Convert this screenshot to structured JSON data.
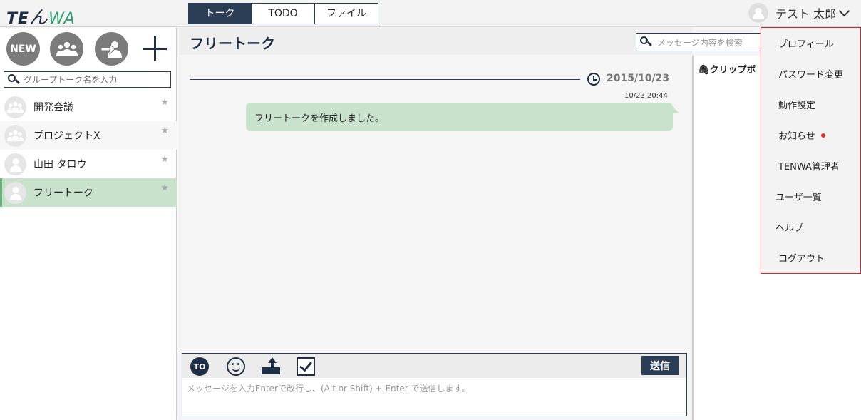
{
  "app": {
    "logo_te": "TE",
    "logo_n": "ん",
    "logo_wa": "WA"
  },
  "tabs": [
    {
      "label": "トーク",
      "active": true
    },
    {
      "label": "TODO",
      "active": false
    },
    {
      "label": "ファイル",
      "active": false
    }
  ],
  "user": {
    "name": "テスト 太郎"
  },
  "sidebar": {
    "new_label": "NEW",
    "search_placeholder": "グループトーク名を入力",
    "rooms": [
      {
        "name": "開発会議",
        "type": "group"
      },
      {
        "name": "プロジェクトX",
        "type": "group"
      },
      {
        "name": "山田 タロウ",
        "type": "user"
      },
      {
        "name": "フリートーク",
        "type": "user",
        "active": true
      }
    ]
  },
  "chat": {
    "title": "フリートーク",
    "search_placeholder": "メッセージ内容を検索",
    "date": "2015/10/23",
    "messages": [
      {
        "time": "10/23 20:44",
        "text": "フリートークを作成しました。"
      }
    ],
    "composer": {
      "to_label": "TO",
      "send_label": "送信",
      "placeholder": "メッセージを入力Enterで改行し、(Alt or Shift) + Enter で送信します。"
    }
  },
  "clip": {
    "title": "クリップボ"
  },
  "menu": [
    {
      "label": "プロフィール"
    },
    {
      "label": "パスワード変更"
    },
    {
      "label": "動作設定"
    },
    {
      "label": "お知らせ",
      "badge": true
    },
    {
      "label": "TENWA管理者"
    },
    {
      "label": "ユーザ一覧"
    },
    {
      "label": "ヘルプ"
    },
    {
      "label": "ログアウト"
    }
  ],
  "colors": {
    "navy": "#2b3e55",
    "accent_green": "#c8e2cb",
    "alert": "#d9232b"
  }
}
